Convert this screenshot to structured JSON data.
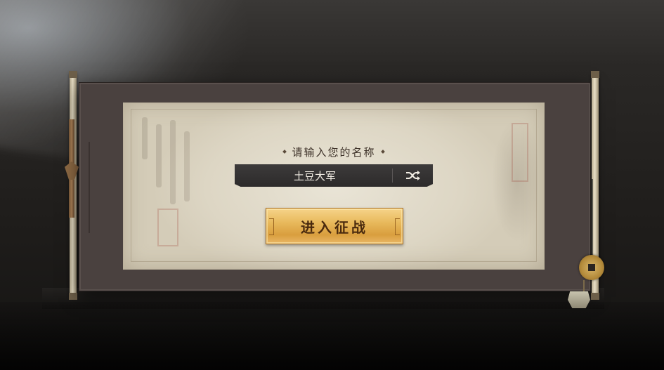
{
  "login": {
    "prompt": "请输入您的名称",
    "name_value": "土豆大军",
    "enter_button_label": "进入征战"
  },
  "icons": {
    "shuffle": "shuffle-icon",
    "pendant": "coin-pendant-icon"
  },
  "colors": {
    "paper": "#e0d9c8",
    "frame": "#4a413f",
    "input_bg": "#333131",
    "button_gold": "#e8b95c",
    "button_text": "#4a2a0e"
  }
}
